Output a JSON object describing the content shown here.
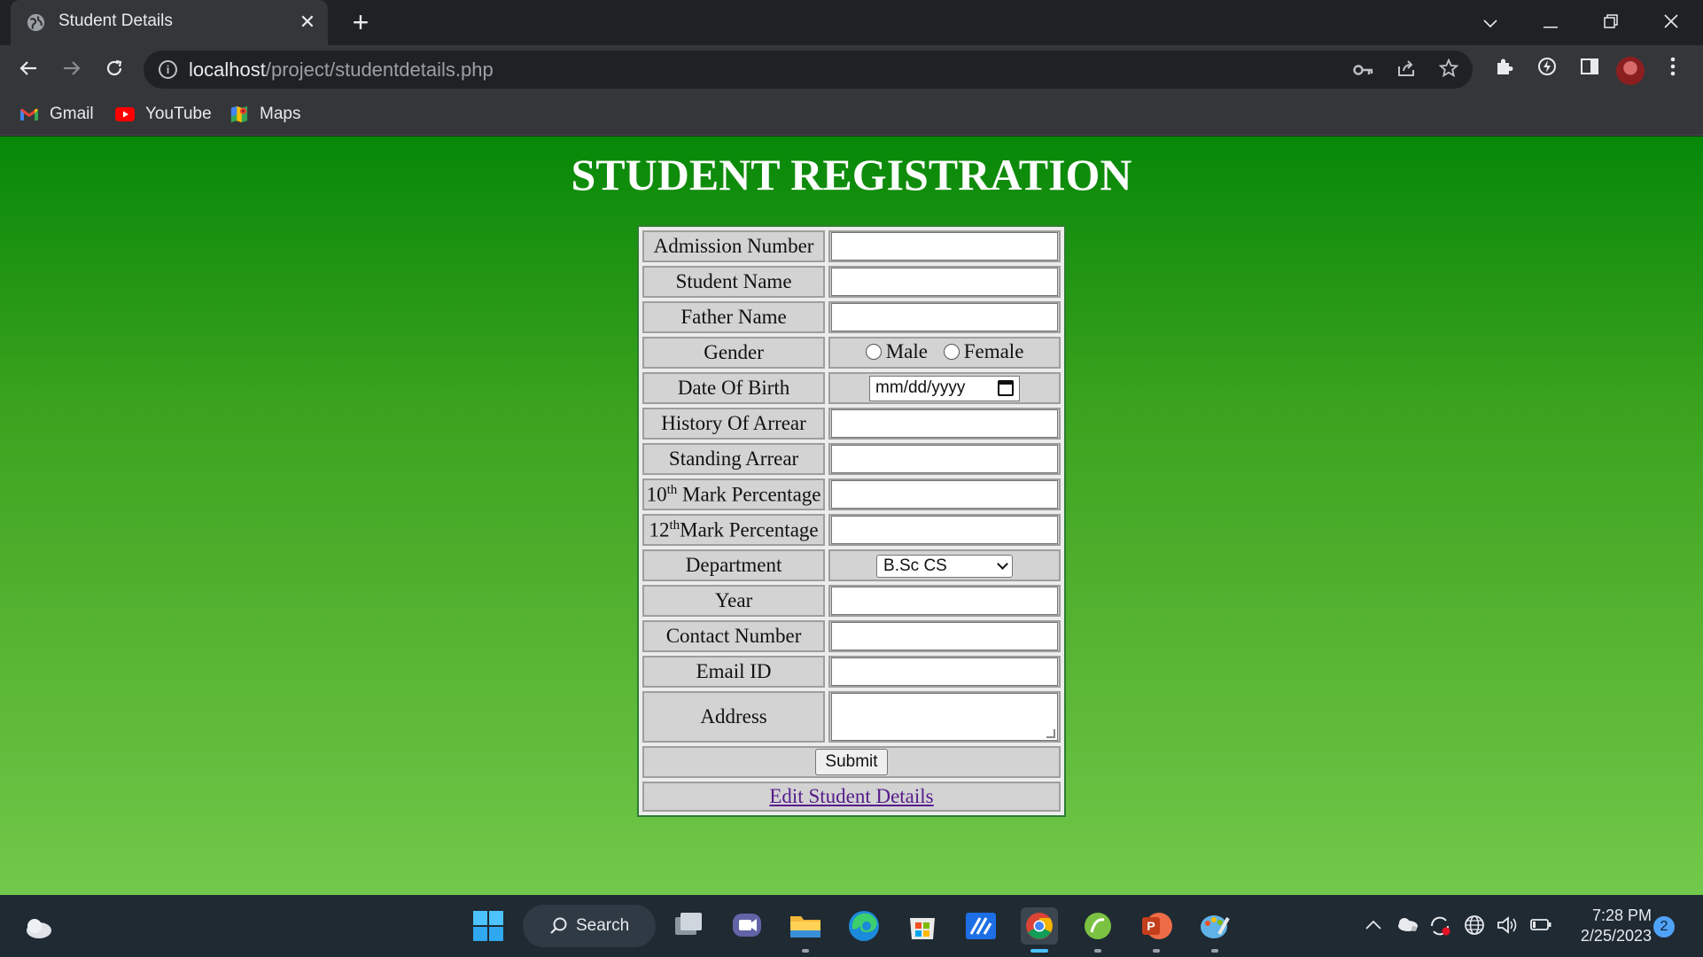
{
  "browser": {
    "tab_title": "Student Details",
    "tab_close": "✕",
    "new_tab": "+",
    "url_host": "localhost",
    "url_path": "/project/studentdetails.php",
    "bookmarks": [
      {
        "label": "Gmail",
        "icon": "gmail-icon"
      },
      {
        "label": "YouTube",
        "icon": "youtube-icon"
      },
      {
        "label": "Maps",
        "icon": "maps-icon"
      }
    ]
  },
  "page": {
    "title": "STUDENT REGISTRATION",
    "form": {
      "admission_number": "Admission Number",
      "student_name": "Student Name",
      "father_name": "Father Name",
      "gender": "Gender",
      "gender_male": "Male",
      "gender_female": "Female",
      "dob": "Date Of Birth",
      "dob_placeholder": "mm/dd/yyyy",
      "history_arrear": "History Of Arrear",
      "standing_arrear": "Standing Arrear",
      "tenth_num": "10",
      "tenth_sup": "th",
      "tenth_rest": " Mark Percentage",
      "twelfth_num": "12",
      "twelfth_sup": "th",
      "twelfth_rest": "Mark Percentage",
      "department": "Department",
      "department_selected": "B.Sc CS",
      "year": "Year",
      "contact_number": "Contact Number",
      "email_id": "Email ID",
      "address": "Address",
      "submit_label": "Submit",
      "edit_link": "Edit Student Details"
    }
  },
  "taskbar": {
    "search_label": "Search",
    "time": "7:28 PM",
    "date": "2/25/2023",
    "notification_count": "2"
  },
  "colors": {
    "page_gradient_top": "#078808",
    "page_gradient_bottom": "#72c84a",
    "cell_bg": "#d3d3d3",
    "link": "#551a8b"
  }
}
